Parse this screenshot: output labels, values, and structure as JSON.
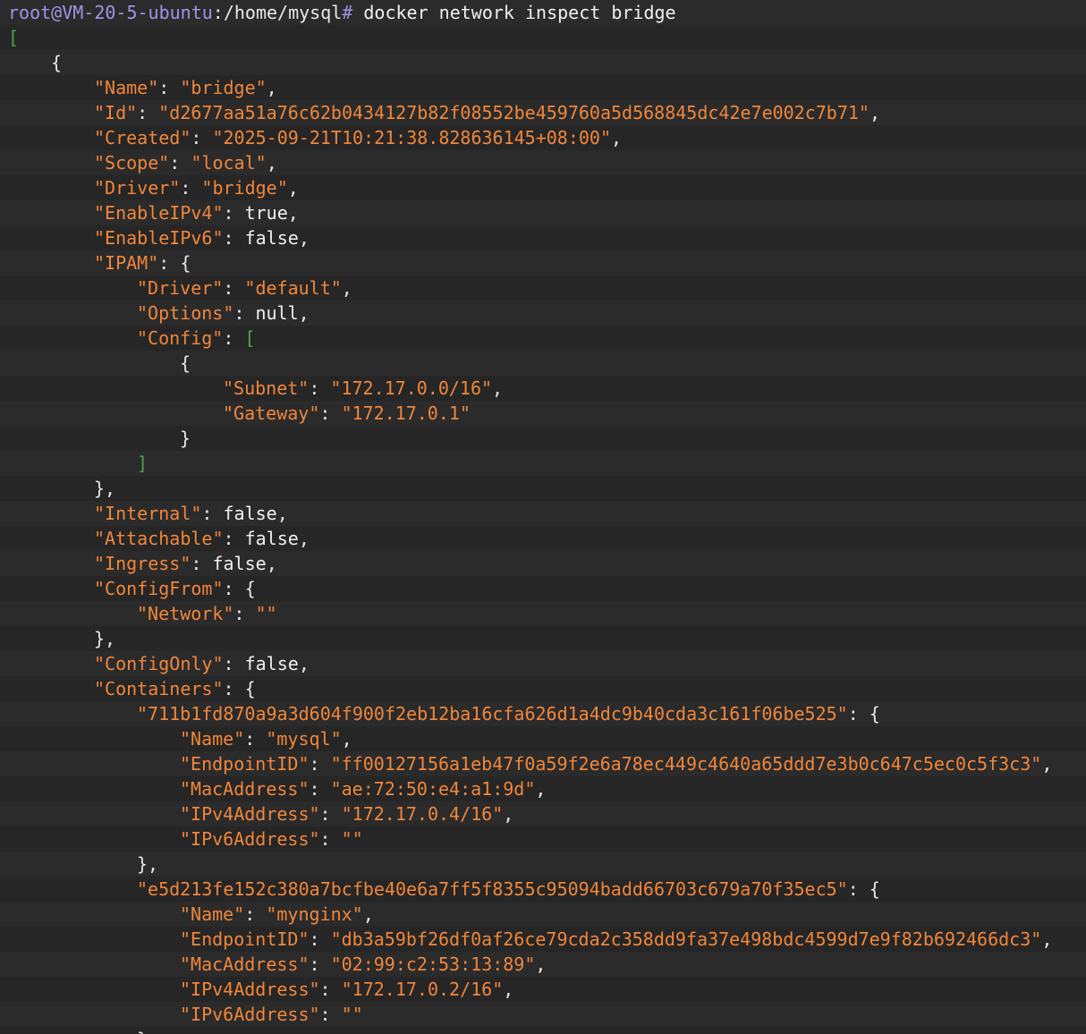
{
  "terminal": {
    "lines": [
      {
        "indent": 0,
        "segs": [
          [
            "prompt",
            "root@VM-20-5-ubuntu"
          ],
          [
            "path",
            ":/home/mysql"
          ],
          [
            "prompt",
            "# "
          ],
          [
            "cmd",
            "docker network inspect bridge"
          ]
        ]
      },
      {
        "indent": 0,
        "segs": [
          [
            "bracket",
            "["
          ]
        ]
      },
      {
        "indent": 4,
        "segs": [
          [
            "punct",
            "{"
          ]
        ]
      },
      {
        "indent": 8,
        "segs": [
          [
            "key",
            "\"Name\""
          ],
          [
            "punct",
            ": "
          ],
          [
            "str",
            "\"bridge\""
          ],
          [
            "punct",
            ","
          ]
        ]
      },
      {
        "indent": 8,
        "segs": [
          [
            "key",
            "\"Id\""
          ],
          [
            "punct",
            ": "
          ],
          [
            "str",
            "\"d2677aa51a76c62b0434127b82f08552be459760a5d568845dc42e7e002c7b71\""
          ],
          [
            "punct",
            ","
          ]
        ]
      },
      {
        "indent": 8,
        "segs": [
          [
            "key",
            "\"Created\""
          ],
          [
            "punct",
            ": "
          ],
          [
            "str",
            "\"2025-09-21T10:21:38.828636145+08:00\""
          ],
          [
            "punct",
            ","
          ]
        ]
      },
      {
        "indent": 8,
        "segs": [
          [
            "key",
            "\"Scope\""
          ],
          [
            "punct",
            ": "
          ],
          [
            "str",
            "\"local\""
          ],
          [
            "punct",
            ","
          ]
        ]
      },
      {
        "indent": 8,
        "segs": [
          [
            "key",
            "\"Driver\""
          ],
          [
            "punct",
            ": "
          ],
          [
            "str",
            "\"bridge\""
          ],
          [
            "punct",
            ","
          ]
        ]
      },
      {
        "indent": 8,
        "segs": [
          [
            "key",
            "\"EnableIPv4\""
          ],
          [
            "punct",
            ": "
          ],
          [
            "lit",
            "true"
          ],
          [
            "punct",
            ","
          ]
        ]
      },
      {
        "indent": 8,
        "segs": [
          [
            "key",
            "\"EnableIPv6\""
          ],
          [
            "punct",
            ": "
          ],
          [
            "lit",
            "false"
          ],
          [
            "punct",
            ","
          ]
        ]
      },
      {
        "indent": 8,
        "segs": [
          [
            "key",
            "\"IPAM\""
          ],
          [
            "punct",
            ": {"
          ]
        ]
      },
      {
        "indent": 12,
        "segs": [
          [
            "key",
            "\"Driver\""
          ],
          [
            "punct",
            ": "
          ],
          [
            "str",
            "\"default\""
          ],
          [
            "punct",
            ","
          ]
        ]
      },
      {
        "indent": 12,
        "segs": [
          [
            "key",
            "\"Options\""
          ],
          [
            "punct",
            ": "
          ],
          [
            "lit",
            "null"
          ],
          [
            "punct",
            ","
          ]
        ]
      },
      {
        "indent": 12,
        "segs": [
          [
            "key",
            "\"Config\""
          ],
          [
            "punct",
            ": "
          ],
          [
            "bracket",
            "["
          ]
        ]
      },
      {
        "indent": 16,
        "segs": [
          [
            "punct",
            "{"
          ]
        ]
      },
      {
        "indent": 20,
        "segs": [
          [
            "key",
            "\"Subnet\""
          ],
          [
            "punct",
            ": "
          ],
          [
            "str",
            "\"172.17.0.0/16\""
          ],
          [
            "punct",
            ","
          ]
        ]
      },
      {
        "indent": 20,
        "segs": [
          [
            "key",
            "\"Gateway\""
          ],
          [
            "punct",
            ": "
          ],
          [
            "str",
            "\"172.17.0.1\""
          ]
        ]
      },
      {
        "indent": 16,
        "segs": [
          [
            "punct",
            "}"
          ]
        ]
      },
      {
        "indent": 12,
        "segs": [
          [
            "bracket",
            "]"
          ]
        ]
      },
      {
        "indent": 8,
        "segs": [
          [
            "punct",
            "},"
          ]
        ]
      },
      {
        "indent": 8,
        "segs": [
          [
            "key",
            "\"Internal\""
          ],
          [
            "punct",
            ": "
          ],
          [
            "lit",
            "false"
          ],
          [
            "punct",
            ","
          ]
        ]
      },
      {
        "indent": 8,
        "segs": [
          [
            "key",
            "\"Attachable\""
          ],
          [
            "punct",
            ": "
          ],
          [
            "lit",
            "false"
          ],
          [
            "punct",
            ","
          ]
        ]
      },
      {
        "indent": 8,
        "segs": [
          [
            "key",
            "\"Ingress\""
          ],
          [
            "punct",
            ": "
          ],
          [
            "lit",
            "false"
          ],
          [
            "punct",
            ","
          ]
        ]
      },
      {
        "indent": 8,
        "segs": [
          [
            "key",
            "\"ConfigFrom\""
          ],
          [
            "punct",
            ": {"
          ]
        ]
      },
      {
        "indent": 12,
        "segs": [
          [
            "key",
            "\"Network\""
          ],
          [
            "punct",
            ": "
          ],
          [
            "str",
            "\"\""
          ]
        ]
      },
      {
        "indent": 8,
        "segs": [
          [
            "punct",
            "},"
          ]
        ]
      },
      {
        "indent": 8,
        "segs": [
          [
            "key",
            "\"ConfigOnly\""
          ],
          [
            "punct",
            ": "
          ],
          [
            "lit",
            "false"
          ],
          [
            "punct",
            ","
          ]
        ]
      },
      {
        "indent": 8,
        "segs": [
          [
            "key",
            "\"Containers\""
          ],
          [
            "punct",
            ": {"
          ]
        ]
      },
      {
        "indent": 12,
        "segs": [
          [
            "str",
            "\"711b1fd870a9a3d604f900f2eb12ba16cfa626d1a4dc9b40cda3c161f06be525\""
          ],
          [
            "punct",
            ": {"
          ]
        ]
      },
      {
        "indent": 16,
        "segs": [
          [
            "key",
            "\"Name\""
          ],
          [
            "punct",
            ": "
          ],
          [
            "str",
            "\"mysql\""
          ],
          [
            "punct",
            ","
          ]
        ]
      },
      {
        "indent": 16,
        "segs": [
          [
            "key",
            "\"EndpointID\""
          ],
          [
            "punct",
            ": "
          ],
          [
            "str",
            "\"ff00127156a1eb47f0a59f2e6a78ec449c4640a65ddd7e3b0c647c5ec0c5f3c3\""
          ],
          [
            "punct",
            ","
          ]
        ]
      },
      {
        "indent": 16,
        "segs": [
          [
            "key",
            "\"MacAddress\""
          ],
          [
            "punct",
            ": "
          ],
          [
            "str",
            "\"ae:72:50:e4:a1:9d\""
          ],
          [
            "punct",
            ","
          ]
        ]
      },
      {
        "indent": 16,
        "segs": [
          [
            "key",
            "\"IPv4Address\""
          ],
          [
            "punct",
            ": "
          ],
          [
            "str",
            "\"172.17.0.4/16\""
          ],
          [
            "punct",
            ","
          ]
        ]
      },
      {
        "indent": 16,
        "segs": [
          [
            "key",
            "\"IPv6Address\""
          ],
          [
            "punct",
            ": "
          ],
          [
            "str",
            "\"\""
          ]
        ]
      },
      {
        "indent": 12,
        "segs": [
          [
            "punct",
            "},"
          ]
        ]
      },
      {
        "indent": 12,
        "segs": [
          [
            "str",
            "\"e5d213fe152c380a7bcfbe40e6a7ff5f8355c95094badd66703c679a70f35ec5\""
          ],
          [
            "punct",
            ": {"
          ]
        ]
      },
      {
        "indent": 16,
        "segs": [
          [
            "key",
            "\"Name\""
          ],
          [
            "punct",
            ": "
          ],
          [
            "str",
            "\"mynginx\""
          ],
          [
            "punct",
            ","
          ]
        ]
      },
      {
        "indent": 16,
        "segs": [
          [
            "key",
            "\"EndpointID\""
          ],
          [
            "punct",
            ": "
          ],
          [
            "str",
            "\"db3a59bf26df0af26ce79cda2c358dd9fa37e498bdc4599d7e9f82b692466dc3\""
          ],
          [
            "punct",
            ","
          ]
        ]
      },
      {
        "indent": 16,
        "segs": [
          [
            "key",
            "\"MacAddress\""
          ],
          [
            "punct",
            ": "
          ],
          [
            "str",
            "\"02:99:c2:53:13:89\""
          ],
          [
            "punct",
            ","
          ]
        ]
      },
      {
        "indent": 16,
        "segs": [
          [
            "key",
            "\"IPv4Address\""
          ],
          [
            "punct",
            ": "
          ],
          [
            "str",
            "\"172.17.0.2/16\""
          ],
          [
            "punct",
            ","
          ]
        ]
      },
      {
        "indent": 16,
        "segs": [
          [
            "key",
            "\"IPv6Address\""
          ],
          [
            "punct",
            ": "
          ],
          [
            "str",
            "\"\""
          ]
        ]
      },
      {
        "indent": 12,
        "segs": [
          [
            "punct",
            "},"
          ]
        ]
      }
    ]
  },
  "colors": {
    "background": "#2b2b2b",
    "stripe": "#262626",
    "prompt": "#9f94e6",
    "key_string": "#f1863a",
    "text": "#e6e6e6",
    "bracket": "#4aa84a"
  }
}
